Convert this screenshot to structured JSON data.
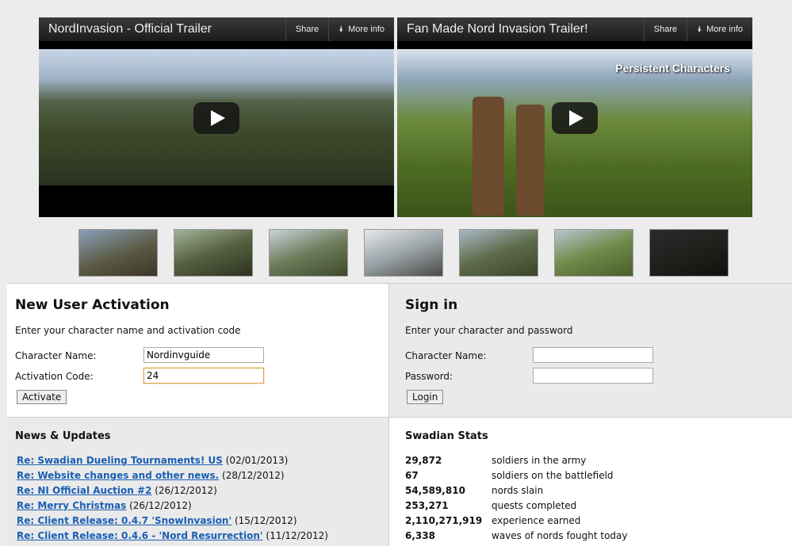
{
  "videos": [
    {
      "title": "NordInvasion - Official Trailer",
      "share": "Share",
      "more_info": "More info",
      "overlay": ""
    },
    {
      "title": "Fan Made Nord Invasion Trailer!",
      "share": "Share",
      "more_info": "More info",
      "overlay": "Persistent Characters"
    }
  ],
  "thumbnails_count": 7,
  "activation": {
    "title": "New User Activation",
    "subtitle": "Enter your character name and activation code",
    "character_label": "Character Name:",
    "character_value": "Nordinvguide",
    "code_label": "Activation Code:",
    "code_value": "24",
    "button": "Activate"
  },
  "signin": {
    "title": "Sign in",
    "subtitle": "Enter your character and password",
    "character_label": "Character Name:",
    "character_value": "",
    "password_label": "Password:",
    "password_value": "",
    "button": "Login"
  },
  "news": {
    "title": "News & Updates",
    "items": [
      {
        "link": "Re: Swadian Dueling Tournaments! US",
        "date": "(02/01/2013)"
      },
      {
        "link": "Re: Website changes and other news.",
        "date": "(28/12/2012)"
      },
      {
        "link": "Re: NI Official Auction #2",
        "date": "(26/12/2012)"
      },
      {
        "link": "Re: Merry Christmas",
        "date": "(26/12/2012)"
      },
      {
        "link": "Re: Client Release: 0.4.7 'SnowInvasion'",
        "date": "(15/12/2012)"
      },
      {
        "link": "Re: Client Release: 0.4.6 - 'Nord Resurrection'",
        "date": "(11/12/2012)"
      }
    ]
  },
  "stats": {
    "title": "Swadian Stats",
    "rows": [
      {
        "value": "29,872",
        "label": "soldiers in the army"
      },
      {
        "value": "67",
        "label": "soldiers on the battlefield"
      },
      {
        "value": "54,589,810",
        "label": "nords slain"
      },
      {
        "value": "253,271",
        "label": "quests completed"
      },
      {
        "value": "2,110,271,919",
        "label": "experience earned"
      },
      {
        "value": "6,338",
        "label": "waves of nords fought today"
      }
    ]
  }
}
